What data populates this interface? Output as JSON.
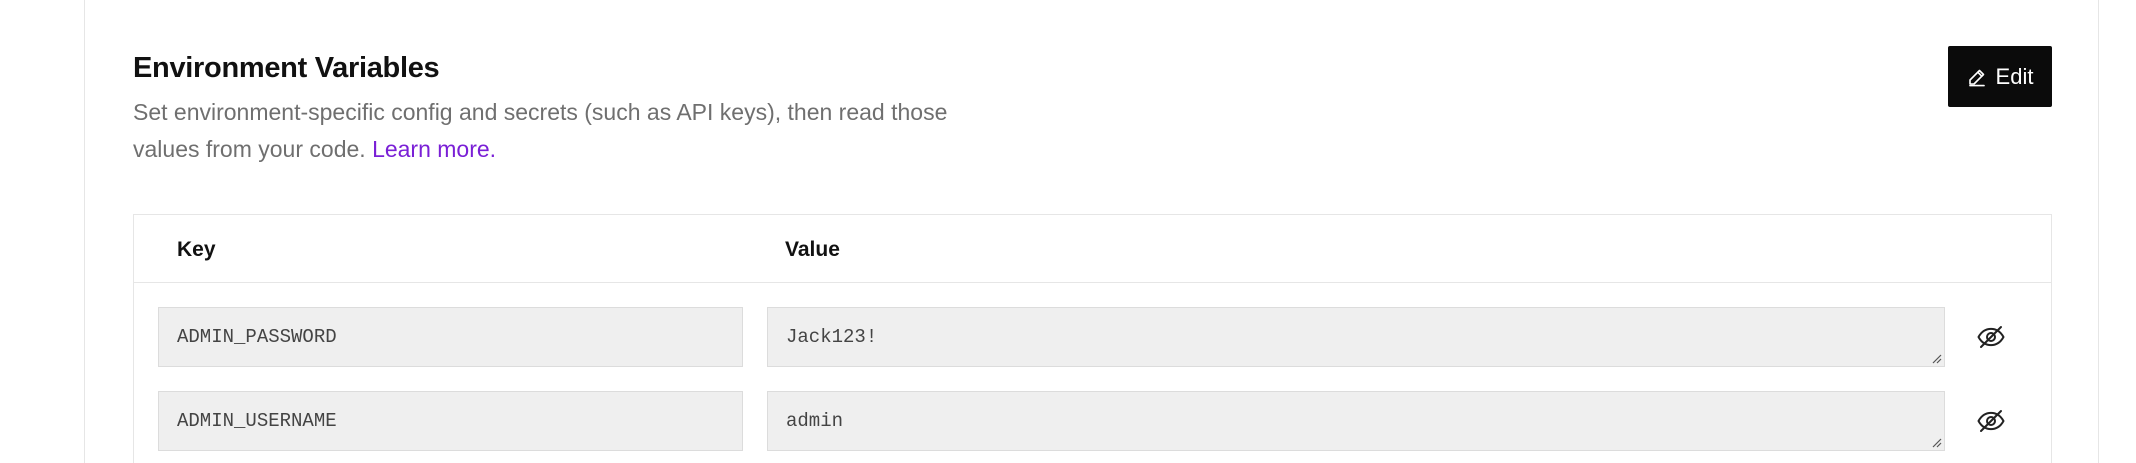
{
  "section": {
    "title": "Environment Variables",
    "description": "Set environment-specific config and secrets (such as API keys), then read those values from your code.",
    "learn_more": "Learn more."
  },
  "toolbar": {
    "edit_label": "Edit",
    "edit_icon": "pencil-icon"
  },
  "table": {
    "columns": [
      "Key",
      "Value"
    ],
    "rows": [
      {
        "key": "ADMIN_PASSWORD",
        "value": "Jack123!",
        "visibility_icon": "eye-slash-icon"
      },
      {
        "key": "ADMIN_USERNAME",
        "value": "admin",
        "visibility_icon": "eye-slash-icon"
      }
    ]
  },
  "colors": {
    "button_bg": "#0b0b0b",
    "link": "#7a1fd6",
    "field_bg": "#efefef",
    "muted_text": "#6f6f6f"
  }
}
